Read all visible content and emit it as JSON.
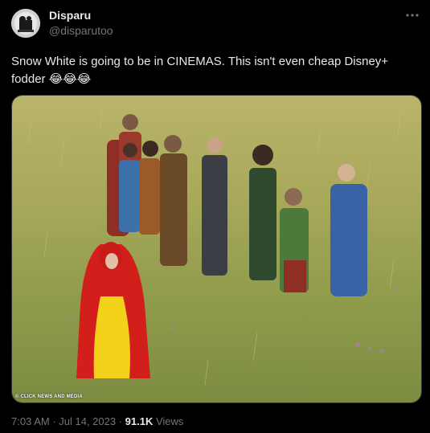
{
  "author": {
    "name": "Disparu",
    "handle": "@disparutoo"
  },
  "tweet": {
    "text": "Snow White is going to be in CINEMAS. This isn't even cheap Disney+ fodder 😂😂😂"
  },
  "media": {
    "credit": "© CLICK NEWS AND MEDIA"
  },
  "meta": {
    "time": "7:03 AM",
    "separator1": " · ",
    "date": "Jul 14, 2023",
    "separator2": " · ",
    "views_count": "91.1K",
    "views_label": " Views"
  },
  "icons": {
    "more": "more-horizontal-icon"
  },
  "colors": {
    "background": "#000000",
    "text_primary": "#e7e9ea",
    "text_secondary": "#71767b"
  }
}
